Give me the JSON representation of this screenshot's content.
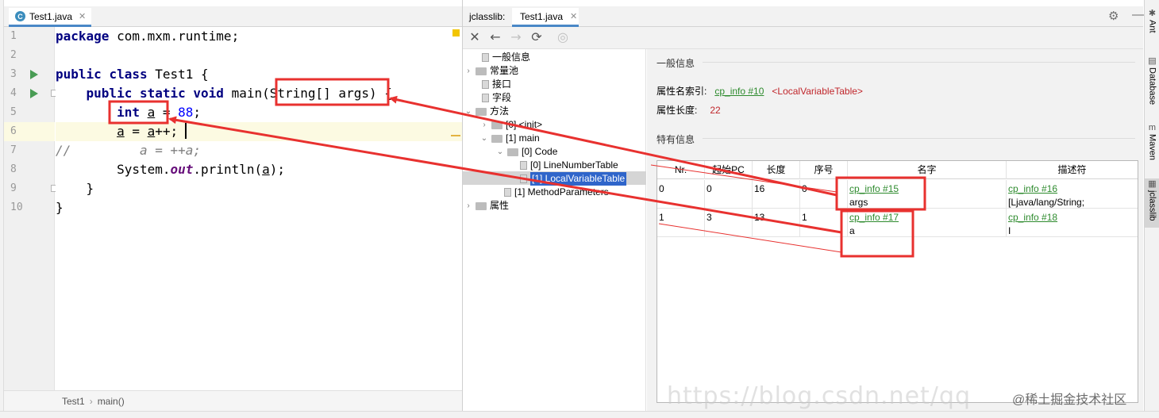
{
  "editor": {
    "tab_label": "Test1.java",
    "tab_icon": "C",
    "lines": [
      {
        "no": "1",
        "run": false,
        "fold": false
      },
      {
        "no": "2",
        "run": false,
        "fold": false
      },
      {
        "no": "3",
        "run": true,
        "fold": false
      },
      {
        "no": "4",
        "run": true,
        "fold": true
      },
      {
        "no": "5",
        "run": false,
        "fold": false
      },
      {
        "no": "6",
        "run": false,
        "fold": false
      },
      {
        "no": "7",
        "run": false,
        "fold": false
      },
      {
        "no": "8",
        "run": false,
        "fold": false
      },
      {
        "no": "9",
        "run": false,
        "fold": true
      },
      {
        "no": "10",
        "run": false,
        "fold": false
      }
    ],
    "code": {
      "l1_kw": "package",
      "l1_rest": " com.mxm.runtime;",
      "l3_kw1": "public",
      "l3_kw2": "class",
      "l3_rest": " Test1 {",
      "l4_kw1": "public",
      "l4_kw2": "static",
      "l4_kw3": "void",
      "l4_a": " main(",
      "l4_b": "String[] args",
      "l4_c": ") {",
      "l5_kw": "int",
      "l5_var": "a",
      "l5_eq": " = ",
      "l5_num": "88",
      "l5_end": ";",
      "l6_a": "a",
      "l6_b": " = ",
      "l6_c": "a",
      "l6_d": "++;",
      "l7": "//         a = ++a;",
      "l8_a": "System.",
      "l8_b": "out",
      "l8_c": ".println(",
      "l8_d": "a",
      "l8_e": ");",
      "l9": "}",
      "l10": "}"
    },
    "breadcrumb": [
      "Test1",
      "main()"
    ],
    "breadcrumb_sep": "›"
  },
  "jclasslib": {
    "title": "jclasslib:",
    "file_tab": "Test1.java",
    "toolbar": [
      "close-icon",
      "back-icon",
      "forward-icon",
      "refresh-icon",
      "browser-icon"
    ],
    "tree": {
      "general": "一般信息",
      "constant_pool": "常量池",
      "interfaces": "接口",
      "fields": "字段",
      "methods": "方法",
      "init": "[0] <init>",
      "main": "[1] main",
      "code": "[0] Code",
      "lnt": "[0] LineNumberTable",
      "lvt": "[1] LocalVariableTable",
      "method_params": "[1] MethodParameters",
      "attributes": "属性"
    },
    "general": {
      "section_title": "一般信息",
      "attr_name_label": "属性名索引:",
      "attr_name_link": "cp_info #10",
      "attr_name_value": "<LocalVariableTable>",
      "attr_len_label": "属性长度:",
      "attr_len_value": "22"
    },
    "specific": {
      "section_title": "特有信息",
      "columns": [
        "Nr.",
        "起始PC",
        "长度",
        "序号",
        "名字",
        "描述符"
      ],
      "rows": [
        {
          "nr": "0",
          "start_pc": "0",
          "length": "16",
          "index": "0",
          "name_link": "cp_info #15",
          "name": "args",
          "desc_link": "cp_info #16",
          "desc": "[Ljava/lang/String;"
        },
        {
          "nr": "1",
          "start_pc": "3",
          "length": "13",
          "index": "1",
          "name_link": "cp_info #17",
          "name": "a",
          "desc_link": "cp_info #18",
          "desc": "I"
        }
      ]
    }
  },
  "sidebar": {
    "tabs": [
      "Ant",
      "Database",
      "Maven",
      "jclasslib"
    ]
  },
  "watermark": "@稀土掘金技术社区",
  "watermark_url": "https://blog.csdn.net/qq",
  "colors": {
    "annotation_red": "#e8312f",
    "link_green": "#2e8b2e",
    "value_red": "#c0262b",
    "selection_blue": "#2f65ca",
    "keyword_navy": "#000080"
  }
}
